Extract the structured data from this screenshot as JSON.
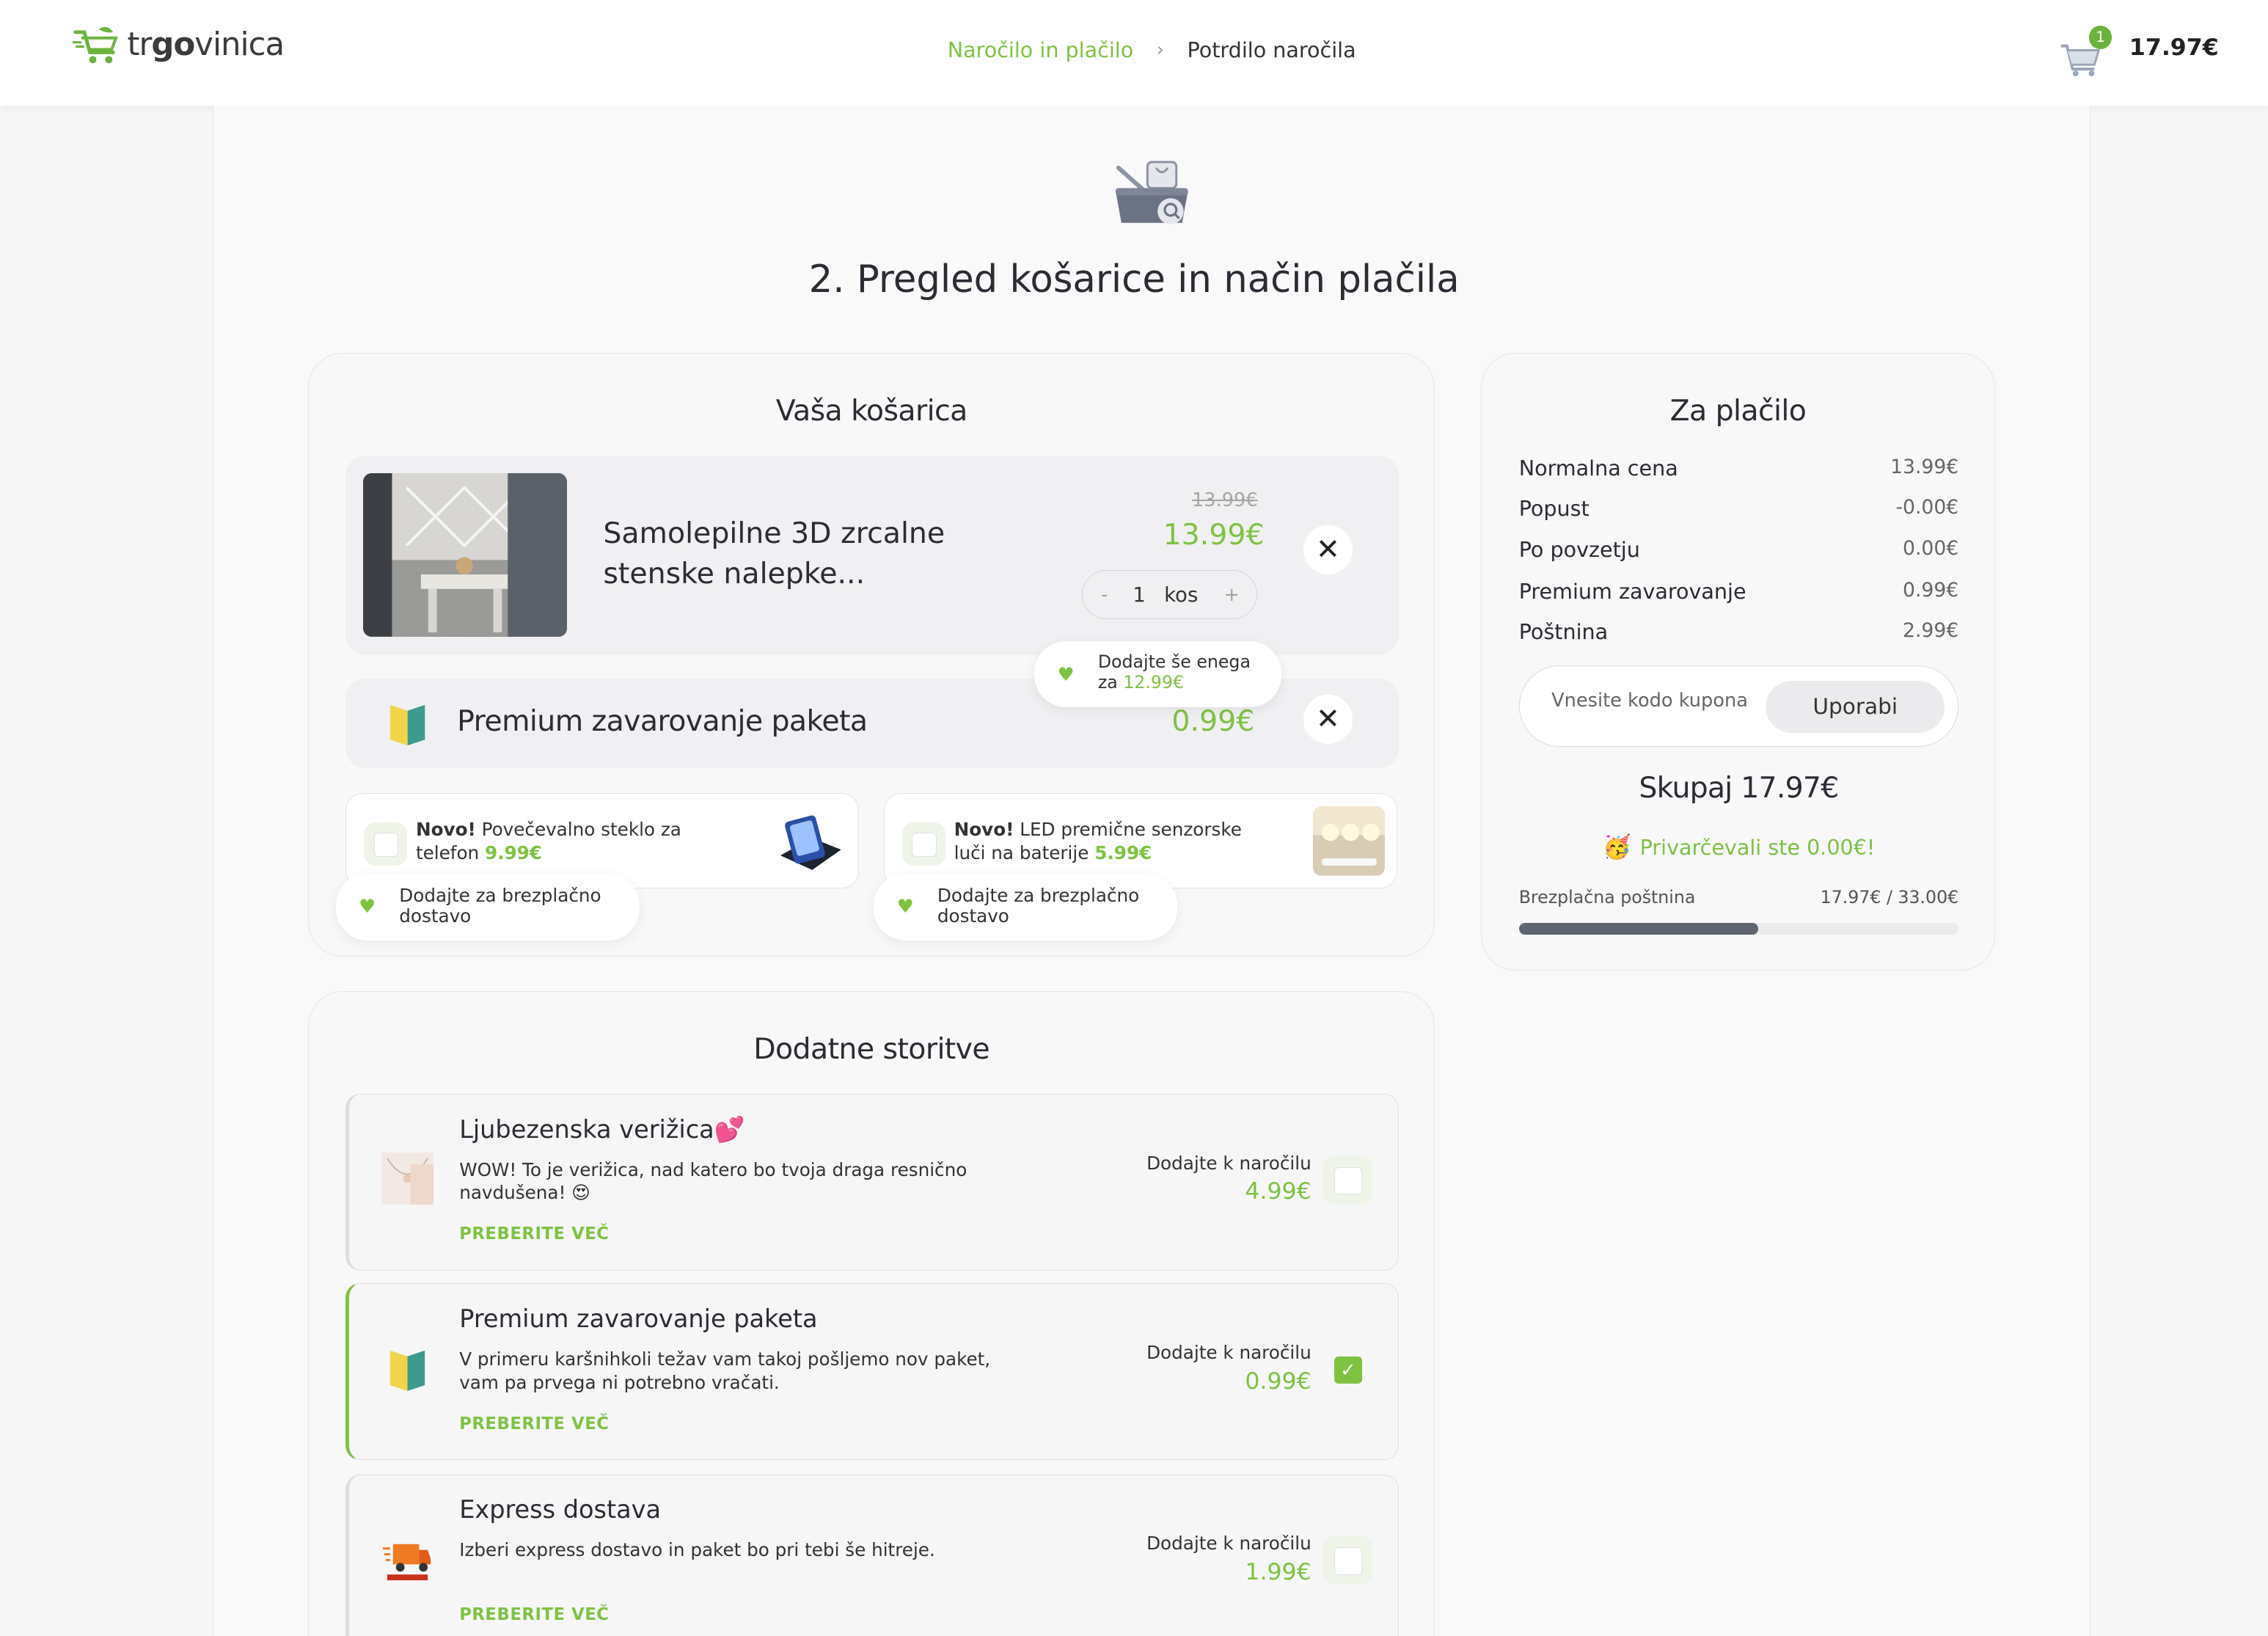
{
  "header": {
    "logo_text_pre": "tr",
    "logo_text_bold": "go",
    "logo_text_post": "vinica",
    "step_active": "Naročilo in plačilo",
    "step_sep": "›",
    "step_next": "Potrdilo naročila",
    "cart_count": "1",
    "cart_total": "17.97€"
  },
  "page_title": "2. Pregled košarice in način plačila",
  "cart": {
    "title": "Vaša košarica",
    "product": {
      "name": "Samolepilne 3D zrcalne stenske nalepke...",
      "old_price": "13.99€",
      "price": "13.99€",
      "qty_minus": "-",
      "qty": "1",
      "qty_unit": "kos",
      "qty_plus": "+",
      "remove": "✕"
    },
    "tooltip": {
      "line1": "Dodajte še enega",
      "line2_pre": "za ",
      "line2_price": "12.99€"
    },
    "insurance": {
      "name": "Premium zavarovanje paketa",
      "price": "0.99€",
      "remove": "✕"
    },
    "upsells": [
      {
        "badge": "Novo!",
        "text": " Povečevalno steklo za telefon ",
        "price": "9.99€",
        "tip": "Dodajte za brezplačno dostavo"
      },
      {
        "badge": "Novo!",
        "text": " LED premične senzorske luči na baterije ",
        "price": "5.99€",
        "tip": "Dodajte za brezplačno dostavo"
      }
    ]
  },
  "summary": {
    "title": "Za plačilo",
    "lines": [
      {
        "label": "Normalna cena",
        "value": "13.99€"
      },
      {
        "label": "Popust",
        "value": "-0.00€"
      },
      {
        "label": "Po povzetju",
        "value": "0.00€"
      },
      {
        "label": "Premium zavarovanje",
        "value": "0.99€"
      },
      {
        "label": "Poštnina",
        "value": "2.99€"
      }
    ],
    "coupon_placeholder": "Vnesite kodo kupona",
    "coupon_button": "Uporabi",
    "total": "Skupaj 17.97€",
    "saved": "Privarčevali ste 0.00€!",
    "free_shipping_label": "Brezplačna poštnina",
    "free_shipping_progress": "17.97€ / 33.00€",
    "free_shipping_fraction": 0.5445,
    "colors": {
      "accent": "#7fc242",
      "progress": "#5e6470"
    }
  },
  "services": {
    "title": "Dodatne storitve",
    "items": [
      {
        "title": "Ljubezenska verižica💕",
        "desc": "WOW! To je verižica, nad katero bo tvoja draga resnično navdušena! 😍",
        "more": "PREBERITE VEČ",
        "add_label": "Dodajte k naročilu",
        "price": "4.99€",
        "checked": false
      },
      {
        "title": "Premium zavarovanje paketa",
        "desc": "V primeru karšnihkoli težav vam takoj pošljemo nov paket, vam pa prvega ni potrebno vračati.",
        "more": "PREBERITE VEČ",
        "add_label": "Dodajte k naročilu",
        "price": "0.99€",
        "checked": true
      },
      {
        "title": "Express dostava",
        "desc": "Izberi express dostavo in paket bo pri tebi še hitreje.",
        "more": "PREBERITE VEČ",
        "add_label": "Dodajte k naročilu",
        "price": "1.99€",
        "checked": false
      }
    ]
  }
}
